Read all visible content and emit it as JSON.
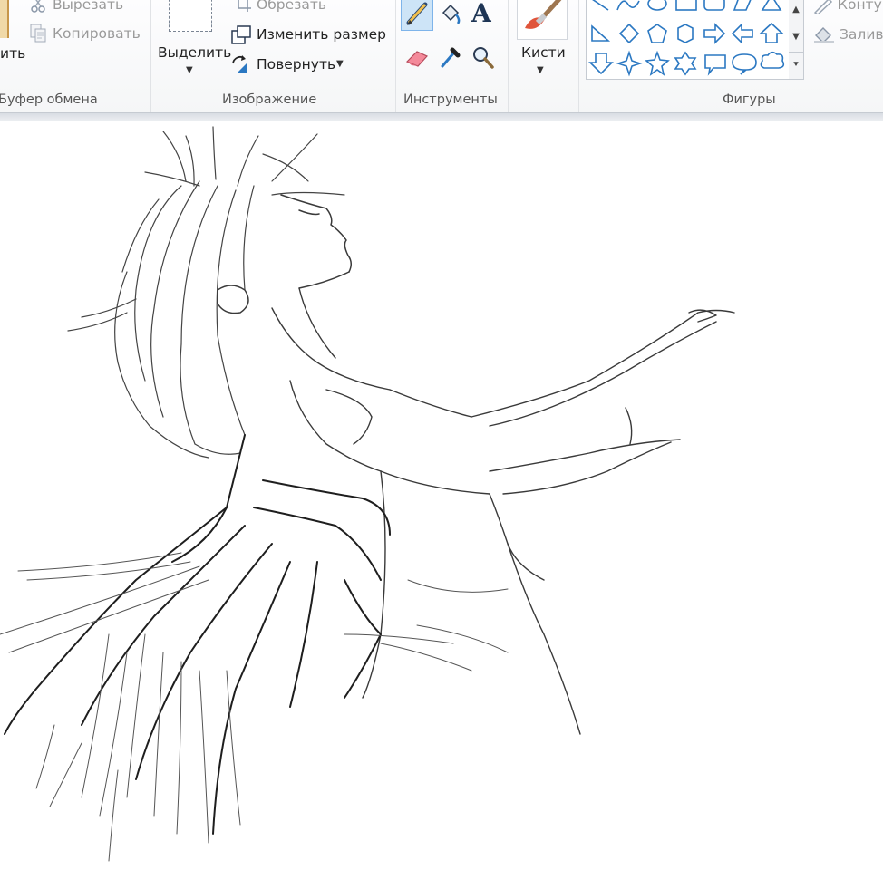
{
  "clipboard": {
    "paste_label": "ить",
    "cut_label": "Вырезать",
    "copy_label": "Копировать",
    "group_label": "Буфер обмена"
  },
  "image": {
    "select_label": "Выделить",
    "crop_label": "Обрезать",
    "resize_label": "Изменить размер",
    "rotate_label": "Повернуть",
    "group_label": "Изображение"
  },
  "tools": {
    "group_label": "Инструменты",
    "text_tool_glyph": "A"
  },
  "brushes": {
    "label": "Кисти"
  },
  "shapes": {
    "group_label": "Фигуры",
    "outline_label": "Контур",
    "fill_label": "Заливка"
  },
  "colors": {
    "accent": "#2b78c2",
    "shape_stroke": "#2b78c2",
    "text": "#222222",
    "disabled_text": "#9a9a9a",
    "sketch": "#3a3a3a"
  }
}
